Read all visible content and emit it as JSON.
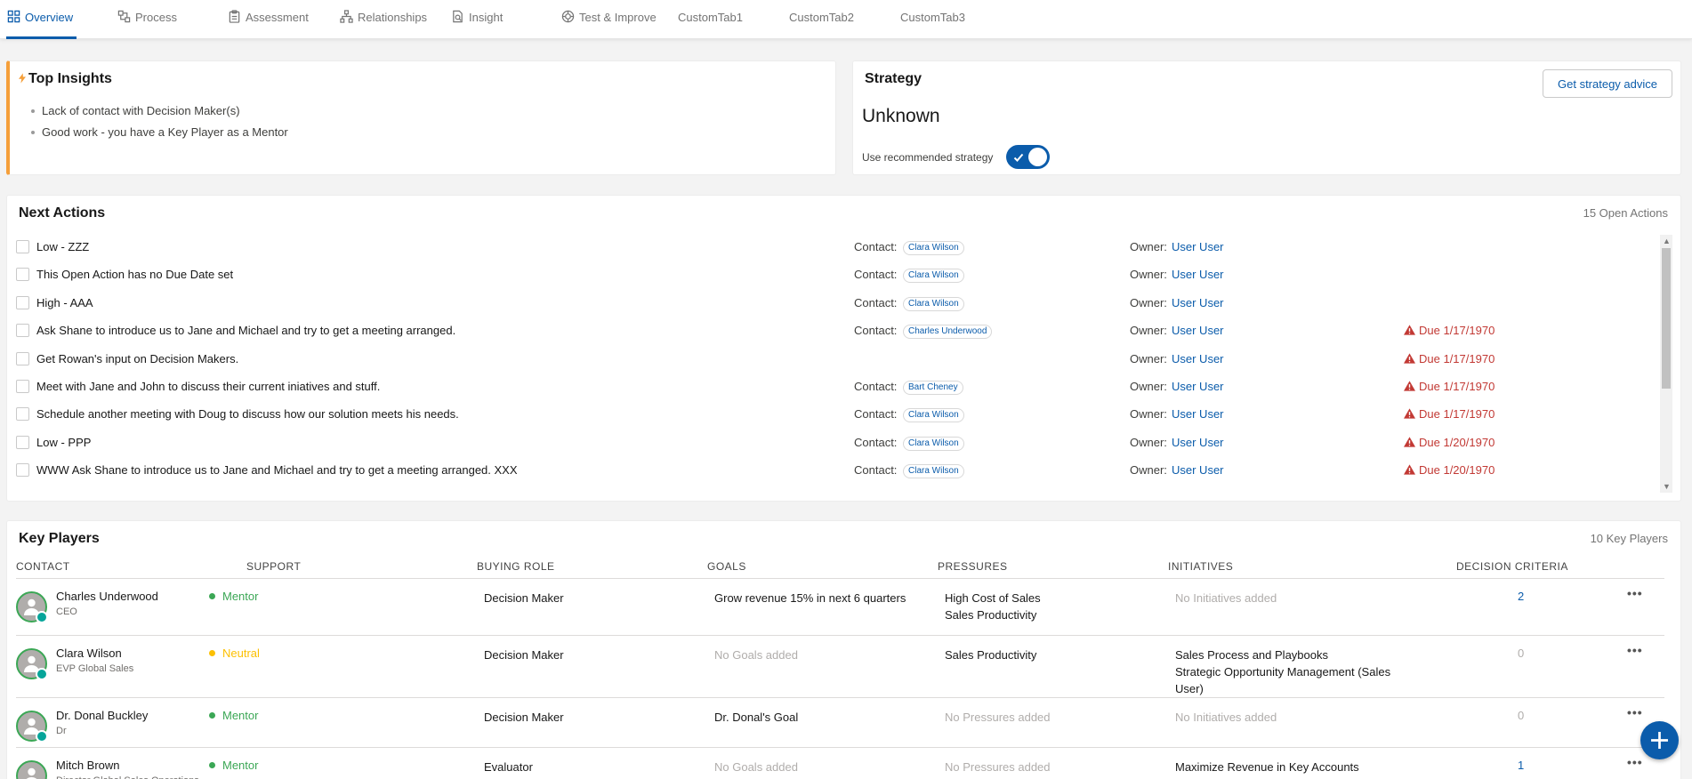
{
  "tabs": [
    {
      "label": "Overview",
      "icon": "grid-icon",
      "active": true
    },
    {
      "label": "Process",
      "icon": "process-icon"
    },
    {
      "label": "Assessment",
      "icon": "clipboard-icon"
    },
    {
      "label": "Relationships",
      "icon": "hierarchy-icon"
    },
    {
      "label": "Insight",
      "icon": "insight-icon"
    },
    {
      "label": "Test & Improve",
      "icon": "test-icon"
    },
    {
      "label": "CustomTab1"
    },
    {
      "label": "CustomTab2"
    },
    {
      "label": "CustomTab3"
    }
  ],
  "insights": {
    "title": "Top Insights",
    "items": [
      "Lack of contact with Decision Maker(s)",
      "Good work - you have a Key Player as a Mentor"
    ]
  },
  "strategy": {
    "title": "Strategy",
    "value": "Unknown",
    "advice_button": "Get strategy advice",
    "toggle_label": "Use recommended strategy",
    "toggle_on": true
  },
  "next_actions": {
    "title": "Next Actions",
    "count_label": "15 Open Actions",
    "contact_label": "Contact:",
    "owner_label": "Owner:",
    "rows": [
      {
        "text": "Low - ZZZ",
        "contact": "Clara Wilson",
        "owner": "User User",
        "due": ""
      },
      {
        "text": "This Open Action has no Due Date set",
        "contact": "Clara Wilson",
        "owner": "User User",
        "due": ""
      },
      {
        "text": "High - AAA",
        "contact": "Clara Wilson",
        "owner": "User User",
        "due": ""
      },
      {
        "text": "Ask Shane to introduce us to Jane and Michael and try to get a meeting arranged.",
        "contact": "Charles Underwood",
        "owner": "User User",
        "due": "Due 1/17/1970"
      },
      {
        "text": "Get Rowan's input on Decision Makers.",
        "contact": "",
        "owner": "User User",
        "due": "Due 1/17/1970"
      },
      {
        "text": "Meet with Jane and John to discuss their current iniatives and stuff.",
        "contact": "Bart Cheney",
        "owner": "User User",
        "due": "Due 1/17/1970"
      },
      {
        "text": "Schedule another meeting with Doug to discuss how our solution meets his needs.",
        "contact": "Clara Wilson",
        "owner": "User User",
        "due": "Due 1/17/1970"
      },
      {
        "text": "Low - PPP",
        "contact": "Clara Wilson",
        "owner": "User User",
        "due": "Due 1/20/1970"
      },
      {
        "text": "WWW Ask Shane to introduce us to Jane and Michael and try to get a meeting arranged. XXX",
        "contact": "Clara Wilson",
        "owner": "User User",
        "due": "Due 1/20/1970"
      }
    ]
  },
  "key_players": {
    "title": "Key Players",
    "count_label": "10 Key Players",
    "columns": [
      "CONTACT",
      "SUPPORT",
      "BUYING ROLE",
      "GOALS",
      "PRESSURES",
      "INITIATIVES",
      "DECISION CRITERIA"
    ],
    "rows": [
      {
        "name": "Charles Underwood",
        "title": "CEO",
        "support": "Mentor",
        "support_color": "#3ba755",
        "role": "Decision Maker",
        "goals": [
          "Grow revenue 15% in next 6 quarters"
        ],
        "pressures": [
          "High Cost of Sales",
          "Sales Productivity"
        ],
        "initiatives": [
          "No Initiatives added"
        ],
        "criteria": "2"
      },
      {
        "name": "Clara Wilson",
        "title": "EVP Global Sales",
        "support": "Neutral",
        "support_color": "#fcc003",
        "role": "Decision Maker",
        "goals": [
          "No Goals added"
        ],
        "pressures": [
          "Sales Productivity"
        ],
        "initiatives": [
          "Sales Process and Playbooks",
          "Strategic Opportunity Management (Sales",
          "User)"
        ],
        "criteria": "0"
      },
      {
        "name": "Dr. Donal Buckley",
        "title": "Dr",
        "support": "Mentor",
        "support_color": "#3ba755",
        "role": "Decision Maker",
        "goals": [
          "Dr. Donal's Goal"
        ],
        "pressures": [
          "No Pressures added"
        ],
        "initiatives": [
          "No Initiatives added"
        ],
        "criteria": "0"
      },
      {
        "name": "Mitch Brown",
        "title": "Director Global Sales Operations",
        "support": "Mentor",
        "support_color": "#3ba755",
        "role": "Evaluator",
        "goals": [
          "No Goals added"
        ],
        "pressures": [
          "No Pressures added"
        ],
        "initiatives": [
          "Maximize Revenue in Key Accounts"
        ],
        "criteria": "1"
      }
    ]
  },
  "colors": {
    "brand": "#0b5cab",
    "warning": "#c23934",
    "insight_accent": "#f59f3a"
  }
}
